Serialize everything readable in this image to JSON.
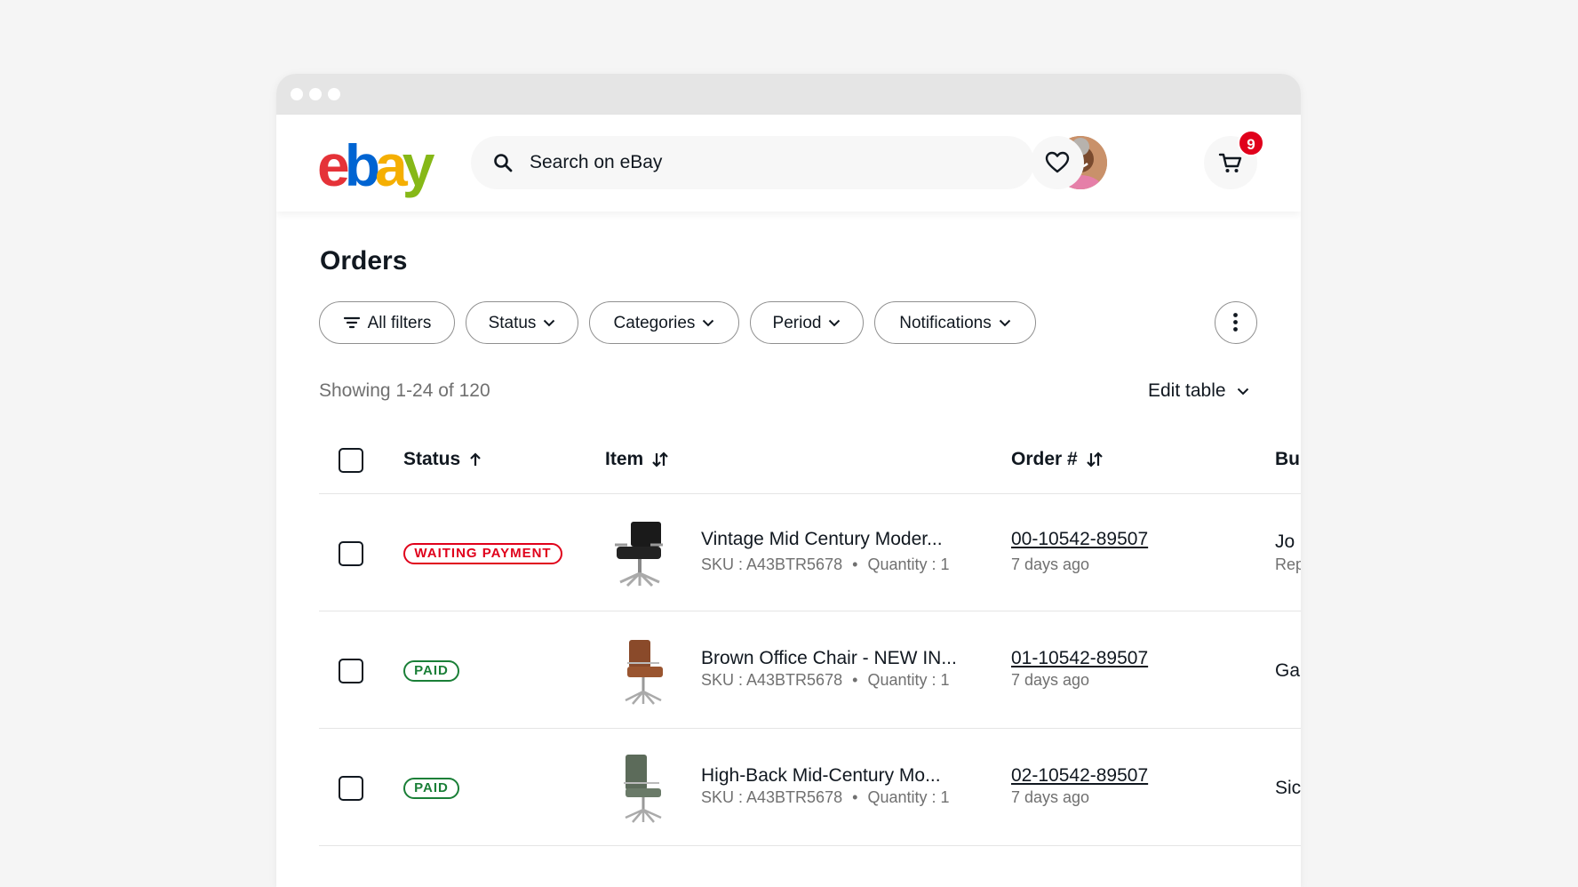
{
  "header": {
    "logo_letters": [
      "e",
      "b",
      "a",
      "y"
    ],
    "search_placeholder": "Search on eBay",
    "cart_count": "9"
  },
  "page": {
    "title": "Orders",
    "filters": {
      "all_filters": "All filters",
      "status": "Status",
      "categories": "Categories",
      "period": "Period",
      "notifications": "Notifications"
    },
    "showing": "Showing 1-24 of 120",
    "edit_table": "Edit table"
  },
  "table": {
    "columns": {
      "status": "Status",
      "item": "Item",
      "order": "Order #",
      "buyer": "Bu"
    },
    "rows": [
      {
        "status": "WAITING PAYMENT",
        "status_type": "waiting",
        "title": "Vintage Mid Century Moder...",
        "sku": "SKU : A43BTR5678",
        "quantity": "Quantity : 1",
        "order_number": "00-10542-89507",
        "age": "7 days ago",
        "buyer": "Jo",
        "buyer_sub": "Rep",
        "thumb_icon": "black-office-chair"
      },
      {
        "status": "PAID",
        "status_type": "paid",
        "title": "Brown Office Chair - NEW IN...",
        "sku": "SKU : A43BTR5678",
        "quantity": "Quantity : 1",
        "order_number": "01-10542-89507",
        "age": "7 days ago",
        "buyer": "Ga",
        "buyer_sub": "",
        "thumb_icon": "brown-office-chair"
      },
      {
        "status": "PAID",
        "status_type": "paid",
        "title": "High-Back Mid-Century Mo...",
        "sku": "SKU : A43BTR5678",
        "quantity": "Quantity : 1",
        "order_number": "02-10542-89507",
        "age": "7 days ago",
        "buyer": "Sic",
        "buyer_sub": "",
        "thumb_icon": "green-office-chair"
      }
    ]
  },
  "colors": {
    "logo_red": "#e53238",
    "logo_blue": "#0064d2",
    "logo_yellow": "#f5af02",
    "logo_green": "#86b817",
    "status_waiting": "#e0001b",
    "status_paid": "#1a7f37",
    "badge": "#e0001b"
  }
}
